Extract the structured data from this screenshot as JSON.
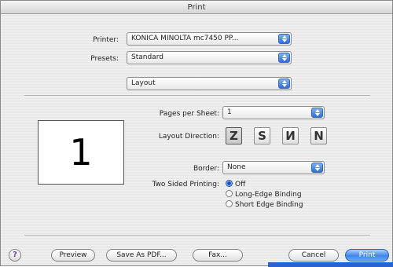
{
  "window": {
    "title": "Print"
  },
  "printer": {
    "label": "Printer:",
    "value": "KONICA MINOLTA mc7450 PP..."
  },
  "presets": {
    "label": "Presets:",
    "value": "Standard"
  },
  "panel": {
    "value": "Layout"
  },
  "preview": {
    "page_number": "1"
  },
  "layout": {
    "pages_per_sheet": {
      "label": "Pages per Sheet:",
      "value": "1"
    },
    "direction": {
      "label": "Layout Direction:",
      "options": [
        {
          "glyph": "Z",
          "icon": "z-order-icon",
          "selected": true
        },
        {
          "glyph": "S",
          "icon": "s-order-icon",
          "selected": false
        },
        {
          "glyph": "И",
          "icon": "n-reverse-order-icon",
          "selected": false
        },
        {
          "glyph": "N",
          "icon": "n-order-icon",
          "selected": false
        }
      ]
    },
    "border": {
      "label": "Border:",
      "value": "None"
    },
    "two_sided": {
      "label": "Two Sided Printing:",
      "options": [
        {
          "label": "Off",
          "selected": true
        },
        {
          "label": "Long-Edge Binding",
          "selected": false
        },
        {
          "label": "Short Edge Binding",
          "selected": false
        }
      ]
    }
  },
  "buttons": {
    "help": "?",
    "preview": "Preview",
    "save_pdf": "Save As PDF...",
    "fax": "Fax...",
    "cancel": "Cancel",
    "print": "Print"
  }
}
